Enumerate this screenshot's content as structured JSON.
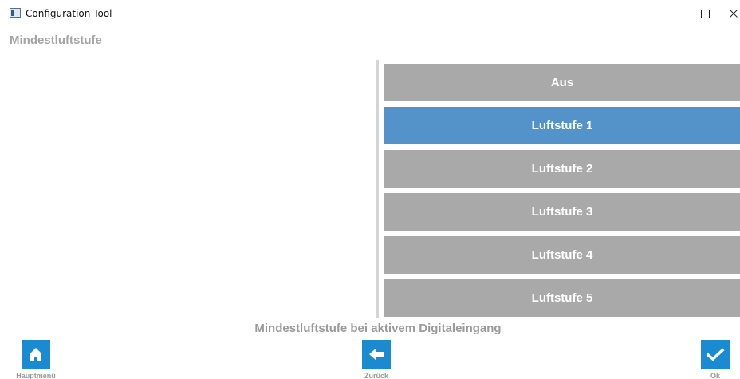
{
  "window": {
    "title": "Configuration Tool",
    "minimize": "–",
    "maximize": "□",
    "close": "✕"
  },
  "page": {
    "title": "Mindestluftstufe",
    "caption": "Mindestluftstufe bei aktivem Digitaleingang"
  },
  "options": [
    {
      "label": "Aus",
      "selected": false
    },
    {
      "label": "Luftstufe 1",
      "selected": true
    },
    {
      "label": "Luftstufe 2",
      "selected": false
    },
    {
      "label": "Luftstufe 3",
      "selected": false
    },
    {
      "label": "Luftstufe 4",
      "selected": false
    },
    {
      "label": "Luftstufe 5",
      "selected": false
    }
  ],
  "footer": {
    "home_label": "Hauptmenü",
    "back_label": "Zurück",
    "ok_label": "Ok"
  },
  "colors": {
    "accent": "#1a8bd1",
    "selected": "#5393c9",
    "option": "#a9a9a9",
    "muted_text": "#9a9a9a"
  }
}
